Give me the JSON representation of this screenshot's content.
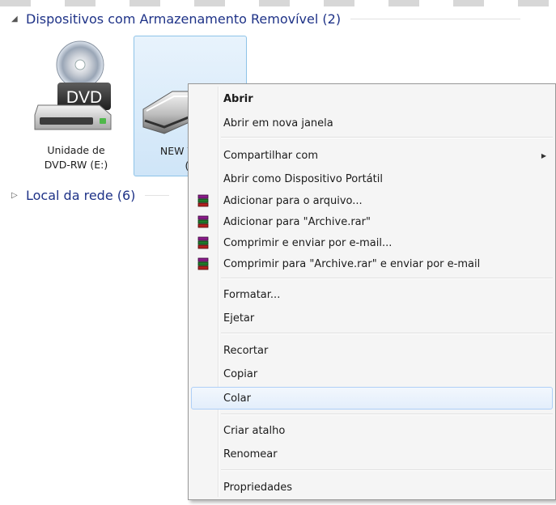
{
  "groups": {
    "removable": {
      "title": "Dispositivos com Armazenamento Removível (2)",
      "expanded": true
    },
    "network": {
      "title": "Local da rede (6)",
      "expanded": false
    }
  },
  "drives": [
    {
      "caption_line1": "Unidade de",
      "caption_line2": "DVD-RW (E:)",
      "icon": "dvd-drive-icon",
      "badge": "DVD"
    },
    {
      "caption_line1": "NEW V",
      "caption_line2": "(",
      "icon": "removable-drive-icon",
      "selected": true
    }
  ],
  "context_menu": {
    "items": {
      "open": "Abrir",
      "open_new_window": "Abrir em nova janela",
      "share_with": "Compartilhar com",
      "open_portable": "Abrir como Dispositivo Portátil",
      "add_to_archive": "Adicionar para o arquivo...",
      "add_to_archive_rar": "Adicionar para \"Archive.rar\"",
      "compress_email": "Comprimir e enviar por e-mail...",
      "compress_rar_email": "Comprimir para \"Archive.rar\" e enviar por e-mail",
      "format": "Formatar...",
      "eject": "Ejetar",
      "cut": "Recortar",
      "copy": "Copiar",
      "paste": "Colar",
      "create_shortcut": "Criar atalho",
      "rename": "Renomear",
      "properties": "Propriedades"
    },
    "hovered_item": "Colar",
    "winrar_icon": "winrar-books-icon"
  },
  "colors": {
    "group_header": "#1e3287",
    "selection_fill": "#cfe5f8",
    "selection_border": "#8ec3e8",
    "menu_background": "#f5f5f5"
  }
}
